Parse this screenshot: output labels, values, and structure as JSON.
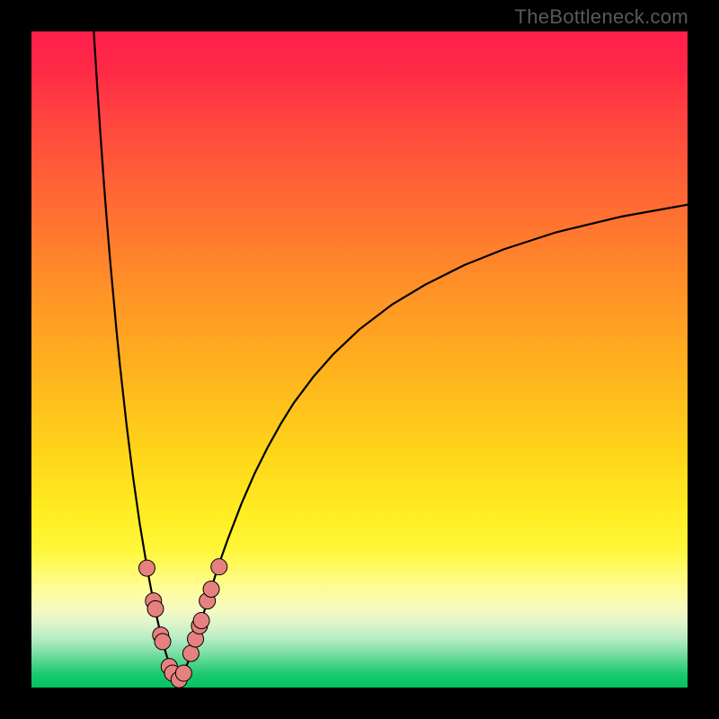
{
  "watermark": "TheBottleneck.com",
  "colors": {
    "frame": "#000000",
    "curve": "#000000",
    "marker_fill": "#e6817f",
    "marker_stroke": "#000000"
  },
  "chart_data": {
    "type": "line",
    "title": "",
    "xlabel": "",
    "ylabel": "",
    "xlim": [
      0,
      100
    ],
    "ylim": [
      0,
      100
    ],
    "curve": {
      "minimum_x": 22,
      "left_branch_top_x": 9.5,
      "right_branch_asymptote_y": 78,
      "x": [
        9.5,
        10,
        10.5,
        11,
        11.5,
        12,
        12.5,
        13,
        13.5,
        14,
        14.5,
        15,
        15.5,
        16,
        16.5,
        17,
        17.5,
        18,
        18.5,
        19,
        19.5,
        20,
        20.5,
        21,
        21.5,
        22,
        23,
        24,
        25,
        26,
        27,
        28,
        29,
        30,
        32,
        34,
        36,
        38,
        40,
        43,
        46,
        50,
        55,
        60,
        66,
        72,
        80,
        90,
        100
      ],
      "y": [
        100,
        92,
        84.5,
        77.5,
        71,
        65,
        59.5,
        54,
        49,
        44.5,
        40,
        36,
        32,
        28.5,
        25,
        22,
        19,
        16.2,
        13.6,
        11.2,
        9,
        7,
        5.2,
        3.6,
        2.2,
        1,
        1.8,
        4.2,
        7.2,
        10.5,
        13.8,
        17,
        20,
        22.8,
        28,
        32.6,
        36.6,
        40.2,
        43.4,
        47.4,
        50.8,
        54.6,
        58.4,
        61.4,
        64.4,
        66.8,
        69.4,
        71.8,
        73.6
      ]
    },
    "markers": {
      "x": [
        17.6,
        18.6,
        18.9,
        19.7,
        20.0,
        21.0,
        21.5,
        22.5,
        23.2,
        24.3,
        25.0,
        25.6,
        25.9,
        26.8,
        27.4,
        28.6
      ],
      "y": [
        18.2,
        13.2,
        12.0,
        8.0,
        7.0,
        3.2,
        2.2,
        1.2,
        2.2,
        5.2,
        7.4,
        9.4,
        10.2,
        13.2,
        15.0,
        18.4
      ]
    }
  }
}
